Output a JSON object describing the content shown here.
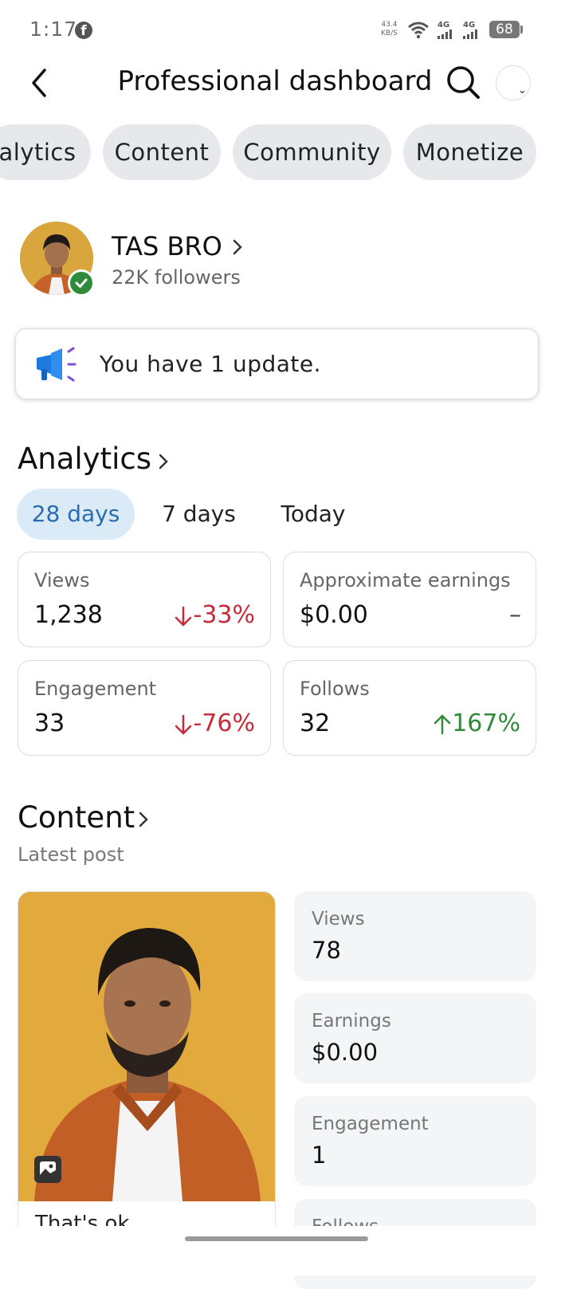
{
  "status_bar": {
    "time": "1:17",
    "net_speed_value": "43.4",
    "net_speed_unit": "KB/S",
    "signal1": "4G",
    "signal2": "4G",
    "battery": "68"
  },
  "header": {
    "title": "Professional dashboard"
  },
  "tabs": [
    {
      "label": "alytics"
    },
    {
      "label": "Content"
    },
    {
      "label": "Community"
    },
    {
      "label": "Monetize"
    }
  ],
  "profile": {
    "name": "TAS BRO",
    "followers": "22K followers"
  },
  "update": {
    "text": "You have 1 update."
  },
  "analytics": {
    "title": "Analytics",
    "ranges": [
      {
        "label": "28 days",
        "active": true
      },
      {
        "label": "7 days",
        "active": false
      },
      {
        "label": "Today",
        "active": false
      }
    ],
    "stats": [
      {
        "label": "Views",
        "value": "1,238",
        "change": "-33%",
        "direction": "down"
      },
      {
        "label": "Approximate earnings",
        "value": "$0.00",
        "change": "–",
        "direction": "none"
      },
      {
        "label": "Engagement",
        "value": "33",
        "change": "-76%",
        "direction": "down"
      },
      {
        "label": "Follows",
        "value": "32",
        "change": "167%",
        "direction": "up"
      }
    ]
  },
  "content": {
    "title": "Content",
    "subtitle": "Latest post",
    "post_caption": "That's ok",
    "metrics": [
      {
        "label": "Views",
        "value": "78"
      },
      {
        "label": "Earnings",
        "value": "$0.00"
      },
      {
        "label": "Engagement",
        "value": "1"
      },
      {
        "label": "Follows",
        "value": ""
      }
    ]
  },
  "colors": {
    "accent_blue": "#2a6cb0",
    "negative_red": "#c62b3a",
    "positive_green": "#2e8b3a",
    "pill_gray": "#e6e8ec"
  }
}
